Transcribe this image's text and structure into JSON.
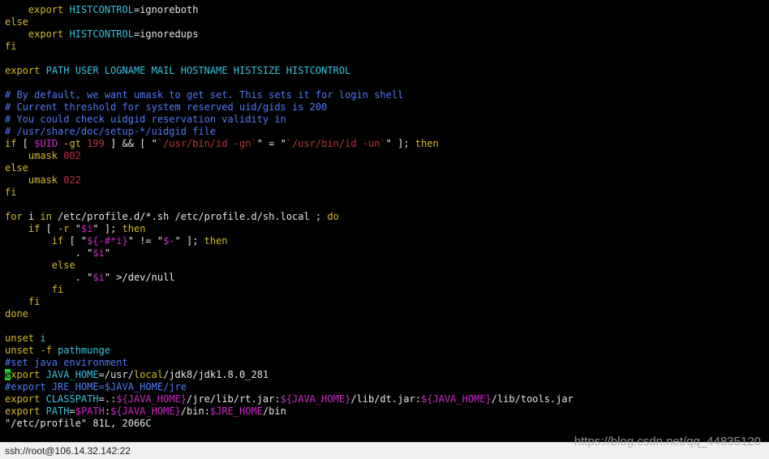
{
  "terminal": {
    "lines": [
      [
        {
          "t": "    "
        },
        {
          "t": "export",
          "c": "yellow"
        },
        {
          "t": " "
        },
        {
          "t": "HISTCONTROL",
          "c": "cyan"
        },
        {
          "t": "=ignoreboth",
          "c": "white"
        }
      ],
      [
        {
          "t": "else",
          "c": "yellow"
        }
      ],
      [
        {
          "t": "    "
        },
        {
          "t": "export",
          "c": "yellow"
        },
        {
          "t": " "
        },
        {
          "t": "HISTCONTROL",
          "c": "cyan"
        },
        {
          "t": "=ignoredups",
          "c": "white"
        }
      ],
      [
        {
          "t": "fi",
          "c": "yellow"
        }
      ],
      [],
      [
        {
          "t": "export",
          "c": "yellow"
        },
        {
          "t": " "
        },
        {
          "t": "PATH USER LOGNAME MAIL HOSTNAME HISTSIZE HISTCONTROL",
          "c": "cyan"
        }
      ],
      [],
      [
        {
          "t": "# By default, we want umask to get set. This sets it for login shell",
          "c": "blue"
        }
      ],
      [
        {
          "t": "# Current threshold for system reserved uid/gids is 200",
          "c": "blue"
        }
      ],
      [
        {
          "t": "# You could check uidgid reservation validity in",
          "c": "blue"
        }
      ],
      [
        {
          "t": "# /usr/share/doc/setup-*/uidgid file",
          "c": "blue"
        }
      ],
      [
        {
          "t": "if",
          "c": "yellow"
        },
        {
          "t": " [ "
        },
        {
          "t": "$UID",
          "c": "magenta"
        },
        {
          "t": " -gt ",
          "c": "yellow"
        },
        {
          "t": "199",
          "c": "red"
        },
        {
          "t": " ] && [ \""
        },
        {
          "t": "`/usr/bin/id -gn`",
          "c": "red"
        },
        {
          "t": "\" = \""
        },
        {
          "t": "`/usr/bin/id -un`",
          "c": "red"
        },
        {
          "t": "\" ]; "
        },
        {
          "t": "then",
          "c": "yellow"
        }
      ],
      [
        {
          "t": "    "
        },
        {
          "t": "umask",
          "c": "yellow"
        },
        {
          "t": " "
        },
        {
          "t": "002",
          "c": "red"
        }
      ],
      [
        {
          "t": "else",
          "c": "yellow"
        }
      ],
      [
        {
          "t": "    "
        },
        {
          "t": "umask",
          "c": "yellow"
        },
        {
          "t": " "
        },
        {
          "t": "022",
          "c": "red"
        }
      ],
      [
        {
          "t": "fi",
          "c": "yellow"
        }
      ],
      [],
      [
        {
          "t": "for",
          "c": "yellow"
        },
        {
          "t": " i "
        },
        {
          "t": "in",
          "c": "yellow"
        },
        {
          "t": " /etc/profile.d/*.sh /etc/profile.d/sh.local ; "
        },
        {
          "t": "do",
          "c": "yellow"
        }
      ],
      [
        {
          "t": "    "
        },
        {
          "t": "if",
          "c": "yellow"
        },
        {
          "t": " [ "
        },
        {
          "t": "-r",
          "c": "yellow"
        },
        {
          "t": " \""
        },
        {
          "t": "$i",
          "c": "magenta"
        },
        {
          "t": "\" ]; "
        },
        {
          "t": "then",
          "c": "yellow"
        }
      ],
      [
        {
          "t": "        "
        },
        {
          "t": "if",
          "c": "yellow"
        },
        {
          "t": " [ \""
        },
        {
          "t": "${-#*i}",
          "c": "magenta"
        },
        {
          "t": "\" != \""
        },
        {
          "t": "$-",
          "c": "magenta"
        },
        {
          "t": "\" ]; "
        },
        {
          "t": "then",
          "c": "yellow"
        }
      ],
      [
        {
          "t": "            . \""
        },
        {
          "t": "$i",
          "c": "magenta"
        },
        {
          "t": "\""
        }
      ],
      [
        {
          "t": "        "
        },
        {
          "t": "else",
          "c": "yellow"
        }
      ],
      [
        {
          "t": "            . \""
        },
        {
          "t": "$i",
          "c": "magenta"
        },
        {
          "t": "\" >/dev/null"
        }
      ],
      [
        {
          "t": "        "
        },
        {
          "t": "fi",
          "c": "yellow"
        }
      ],
      [
        {
          "t": "    "
        },
        {
          "t": "fi",
          "c": "yellow"
        }
      ],
      [
        {
          "t": "done",
          "c": "yellow"
        }
      ],
      [],
      [
        {
          "t": "unset",
          "c": "yellow"
        },
        {
          "t": " "
        },
        {
          "t": "i",
          "c": "cyan"
        }
      ],
      [
        {
          "t": "unset",
          "c": "yellow"
        },
        {
          "t": " "
        },
        {
          "t": "-f",
          "c": "yellow"
        },
        {
          "t": " "
        },
        {
          "t": "pathmunge",
          "c": "cyan"
        }
      ],
      [
        {
          "t": "#set java environment",
          "c": "blue"
        }
      ],
      [
        {
          "t": "e",
          "c": "cursor"
        },
        {
          "t": "xport",
          "c": "yellow"
        },
        {
          "t": " "
        },
        {
          "t": "JAVA_HOME",
          "c": "cyan"
        },
        {
          "t": "=/usr/"
        },
        {
          "t": "local",
          "c": "yellow"
        },
        {
          "t": "/jdk8/jdk1.8.0_281"
        }
      ],
      [
        {
          "t": "#export JRE_HOME=$JAVA_HOME/jre",
          "c": "blue"
        }
      ],
      [
        {
          "t": "export",
          "c": "yellow"
        },
        {
          "t": " "
        },
        {
          "t": "CLASSPATH",
          "c": "cyan"
        },
        {
          "t": "=.:"
        },
        {
          "t": "${JAVA_HOME}",
          "c": "magenta"
        },
        {
          "t": "/jre/lib/rt.jar:"
        },
        {
          "t": "${JAVA_HOME}",
          "c": "magenta"
        },
        {
          "t": "/lib/dt.jar:"
        },
        {
          "t": "${JAVA_HOME}",
          "c": "magenta"
        },
        {
          "t": "/lib/tools.jar"
        }
      ],
      [
        {
          "t": "export",
          "c": "yellow"
        },
        {
          "t": " "
        },
        {
          "t": "PATH",
          "c": "cyan"
        },
        {
          "t": "="
        },
        {
          "t": "$PATH",
          "c": "magenta"
        },
        {
          "t": ":"
        },
        {
          "t": "${JAVA_HOME}",
          "c": "magenta"
        },
        {
          "t": "/bin:"
        },
        {
          "t": "$JRE_HOME",
          "c": "magenta"
        },
        {
          "t": "/bin"
        }
      ],
      [
        {
          "t": "\"/etc/profile\" 81L, 2066C"
        }
      ]
    ]
  },
  "statusbar": {
    "connection": "ssh://root@106.14.32.142:22"
  },
  "watermark": "https://blog.csdn.net/qq_44835120"
}
